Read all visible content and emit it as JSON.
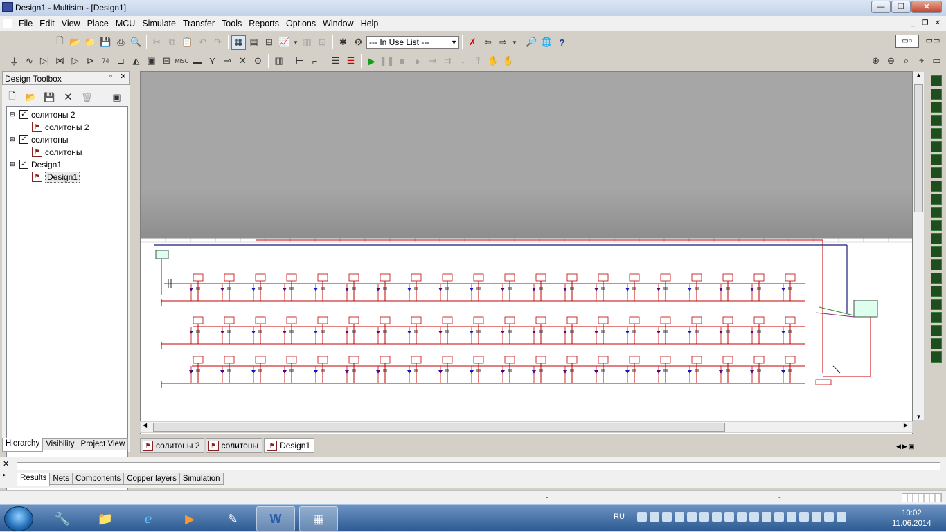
{
  "window": {
    "title": "Design1 - Multisim - [Design1]"
  },
  "menu": [
    "File",
    "Edit",
    "View",
    "Place",
    "MCU",
    "Simulate",
    "Transfer",
    "Tools",
    "Reports",
    "Options",
    "Window",
    "Help"
  ],
  "toolbar": {
    "inuse_list": "--- In Use List ---"
  },
  "toolbox": {
    "title": "Design Toolbox",
    "tree": [
      {
        "label": "солитоны 2",
        "child": "солитоны 2"
      },
      {
        "label": "солитоны",
        "child": "солитоны"
      },
      {
        "label": "Design1",
        "child": "Design1"
      }
    ],
    "tabs": [
      "Hierarchy",
      "Visibility",
      "Project View"
    ]
  },
  "sheet_tabs": [
    "солитоны 2",
    "солитоны",
    "Design1"
  ],
  "spreadsheet_tabs": [
    "Results",
    "Nets",
    "Components",
    "Copper layers",
    "Simulation"
  ],
  "status": {
    "left": "-",
    "right": "-"
  },
  "taskbar": {
    "lang": "RU",
    "time": "10:02",
    "date": "11.06.2014"
  },
  "colors": {
    "wire_red": "#c00000",
    "wire_blue": "#1a1a7a",
    "diode_blue": "#1010c0",
    "accent": "#3b4fa0"
  }
}
